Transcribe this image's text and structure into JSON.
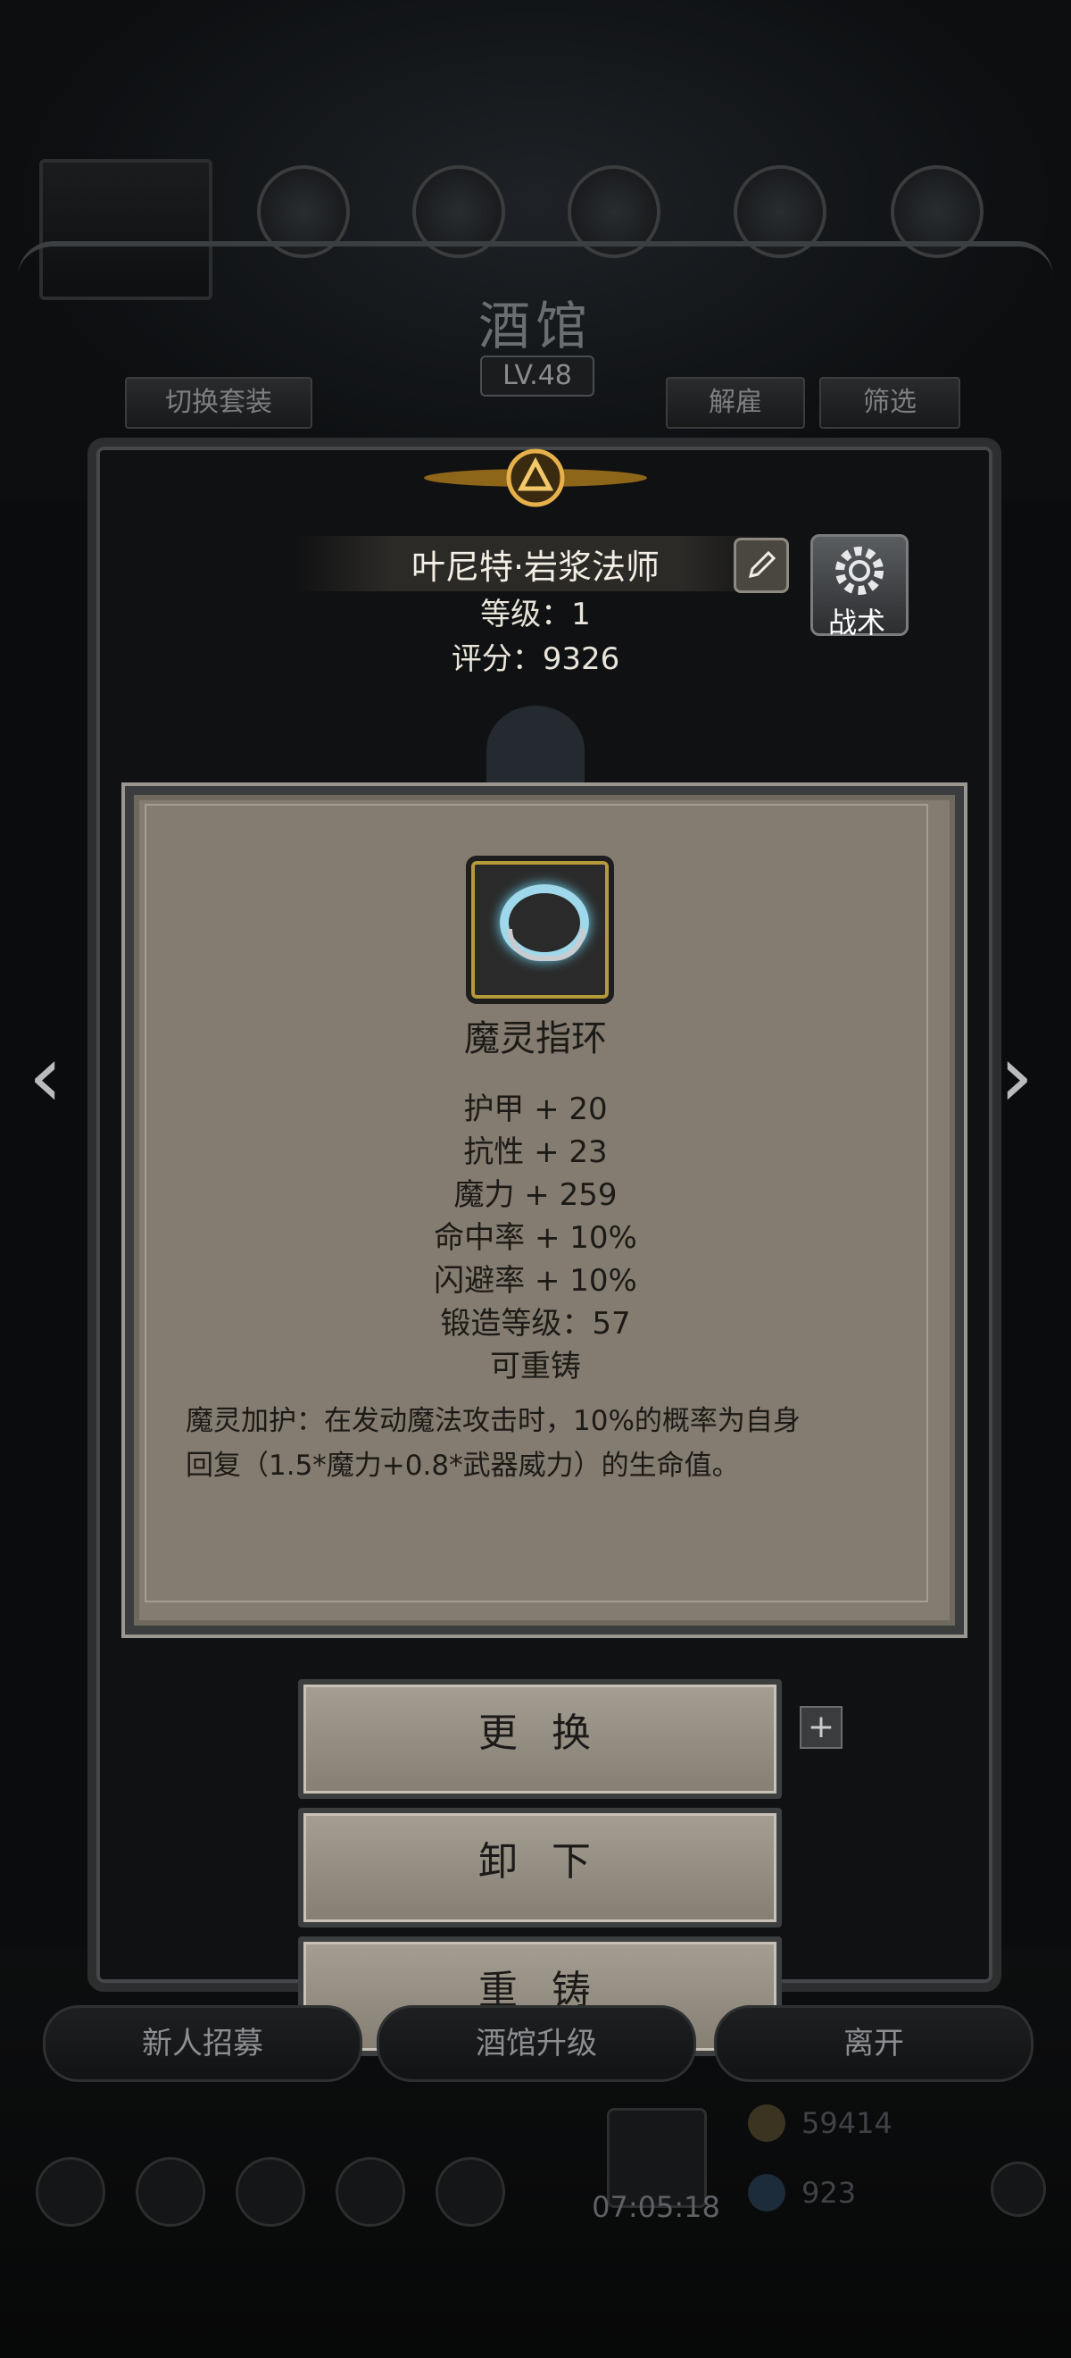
{
  "tavern": {
    "title": "酒馆",
    "level": "LV.48",
    "switch_outfit_label": "切换套装",
    "dismiss_label": "解雇",
    "filter_label": "筛选"
  },
  "hero": {
    "name": "叶尼特·岩浆法师",
    "level_text": "等级：1",
    "score_text": "评分：9326",
    "tactics_label": "战术"
  },
  "item": {
    "icon": "ring-icon",
    "name": "魔灵指环",
    "stats": [
      "护甲 + 20",
      "抗性 + 23",
      "魔力 + 259",
      "命中率 + 10%",
      "闪避率 + 10%",
      "锻造等级：57",
      "可重铸"
    ],
    "description_line1": "魔灵加护：在发动魔法攻击时，10%的概率为自身",
    "description_line2": "回复（1.5*魔力+0.8*武器威力）的生命值。"
  },
  "actions": {
    "replace_label": "更 换",
    "unequip_label": "卸 下",
    "reforge_label": "重 铸"
  },
  "bottom_bar": {
    "recruit_label": "新人招募",
    "upgrade_label": "酒馆升级",
    "leave_label": "离开",
    "gift_timer": "07:05:18",
    "gold_amount": "59414",
    "gem_amount": "923"
  },
  "colors": {
    "panel_bg": "#847c70",
    "button_bg": "#a59e92",
    "text_dark": "#1c1a16",
    "text_light": "#e9e5da",
    "ring_glow": "#9ed8ea",
    "gold_frame": "#b59a3a"
  }
}
